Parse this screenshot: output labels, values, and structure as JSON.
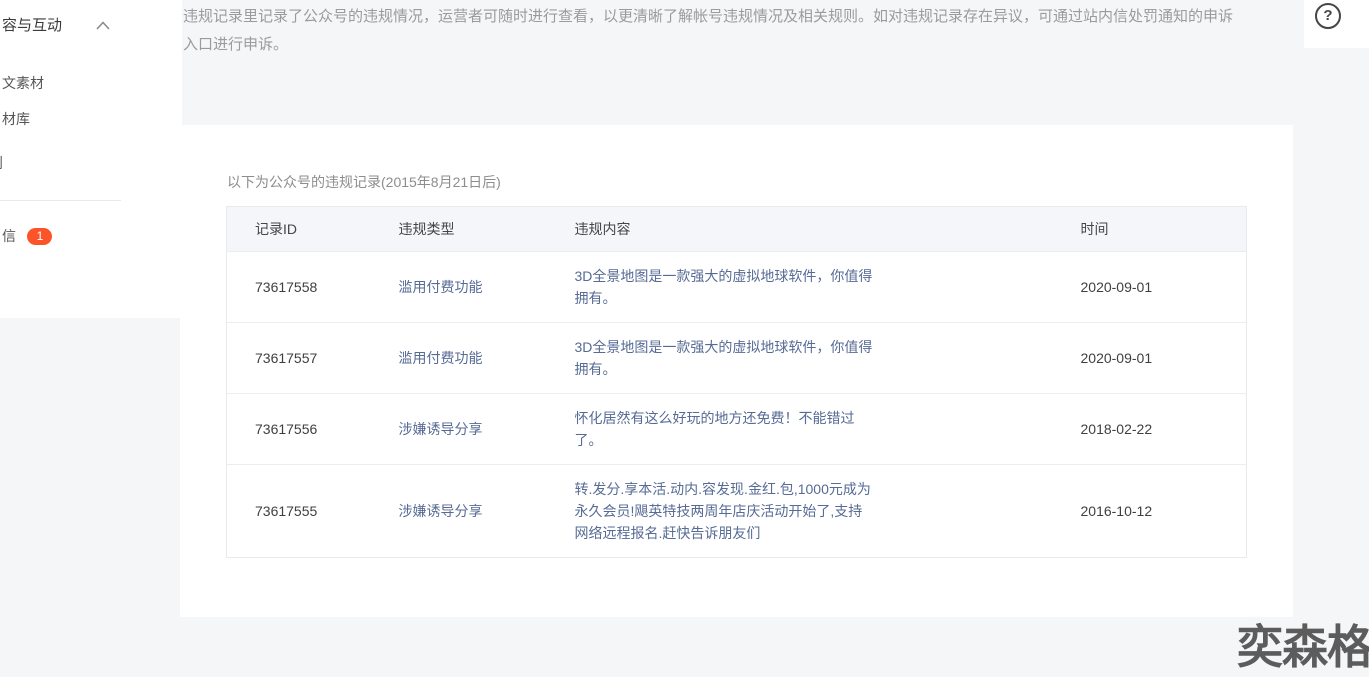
{
  "sidebar": {
    "group_label": "容与互动",
    "items": [
      {
        "label": "文素材"
      },
      {
        "label": "材库"
      },
      {
        "label": "则"
      }
    ],
    "message_item": {
      "label": "信",
      "badge": "1"
    }
  },
  "page": {
    "description": "违规记录里记录了公众号的违规情况，运营者可随时进行查看，以更清晰了解帐号违规情况及相关规则。如对违规记录存在异议，可通过站内信处罚通知的申诉\n入口进行申诉。",
    "help_icon": "?"
  },
  "records": {
    "title": "以下为公众号的违规记录(2015年8月21日后)",
    "table": {
      "columns": [
        "记录ID",
        "违规类型",
        "违规内容",
        "时间"
      ],
      "rows": [
        {
          "id": "73617558",
          "type": "滥用付费功能",
          "content": "3D全景地图是一款强大的虚拟地球软件，你值得\n拥有。",
          "date": "2020-09-01"
        },
        {
          "id": "73617557",
          "type": "滥用付费功能",
          "content": "3D全景地图是一款强大的虚拟地球软件，你值得\n拥有。",
          "date": "2020-09-01"
        },
        {
          "id": "73617556",
          "type": "涉嫌诱导分享",
          "content": "怀化居然有这么好玩的地方还免费！不能错过\n了。",
          "date": "2018-02-22"
        },
        {
          "id": "73617555",
          "type": "涉嫌诱导分享",
          "content": "转.发分.享本活.动内.容发现.金红.包,1000元成为\n永久会员!飓英特技两周年店庆活动开始了,支持\n网络远程报名.赶快告诉朋友们",
          "date": "2016-10-12"
        }
      ]
    }
  },
  "watermark": "奕森格",
  "colors": {
    "link": "#576b95",
    "badge": "#fc5329",
    "page_bg": "#f5f6f8"
  }
}
